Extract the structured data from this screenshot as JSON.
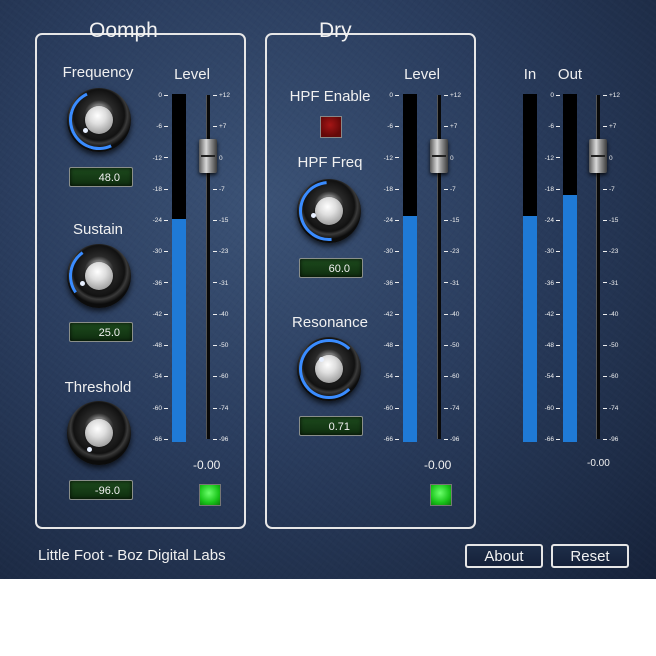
{
  "footer": {
    "brand": "Little Foot - Boz Digital Labs"
  },
  "buttons": {
    "about": "About",
    "reset": "Reset"
  },
  "oomph": {
    "title": "Oomph",
    "frequency": {
      "label": "Frequency",
      "value": "48.0"
    },
    "sustain": {
      "label": "Sustain",
      "value": "25.0"
    },
    "threshold": {
      "label": "Threshold",
      "value": "-96.0"
    },
    "level_label": "Level",
    "level_readout": "-0.00",
    "meter_level": 0.64,
    "led": "on"
  },
  "dry": {
    "title": "Dry",
    "hpf_enable": {
      "label": "HPF Enable",
      "state": "off"
    },
    "hpf_freq": {
      "label": "HPF Freq",
      "value": "60.0"
    },
    "resonance": {
      "label": "Resonance",
      "value": "0.71"
    },
    "level_label": "Level",
    "level_readout": "-0.00",
    "meter_level": 0.65,
    "led": "on"
  },
  "io": {
    "in_label": "In",
    "out_label": "Out",
    "out_readout": "-0.00",
    "in_level": 0.65,
    "out_level": 0.71
  },
  "meter_scale": [
    "0",
    "-6",
    "-12",
    "-18",
    "-24",
    "-30",
    "-36",
    "-42",
    "-48",
    "-54",
    "-60",
    "-66"
  ],
  "fader_scale": [
    "+12",
    "+7",
    "0",
    "-7",
    "-15",
    "-23",
    "-31",
    "-40",
    "-50",
    "-60",
    "-74",
    "-96"
  ],
  "colors": {
    "meter_fill": "#1f7ad6",
    "led_green": "#19c419",
    "led_red": "#640808",
    "lcd": "#173c17"
  }
}
